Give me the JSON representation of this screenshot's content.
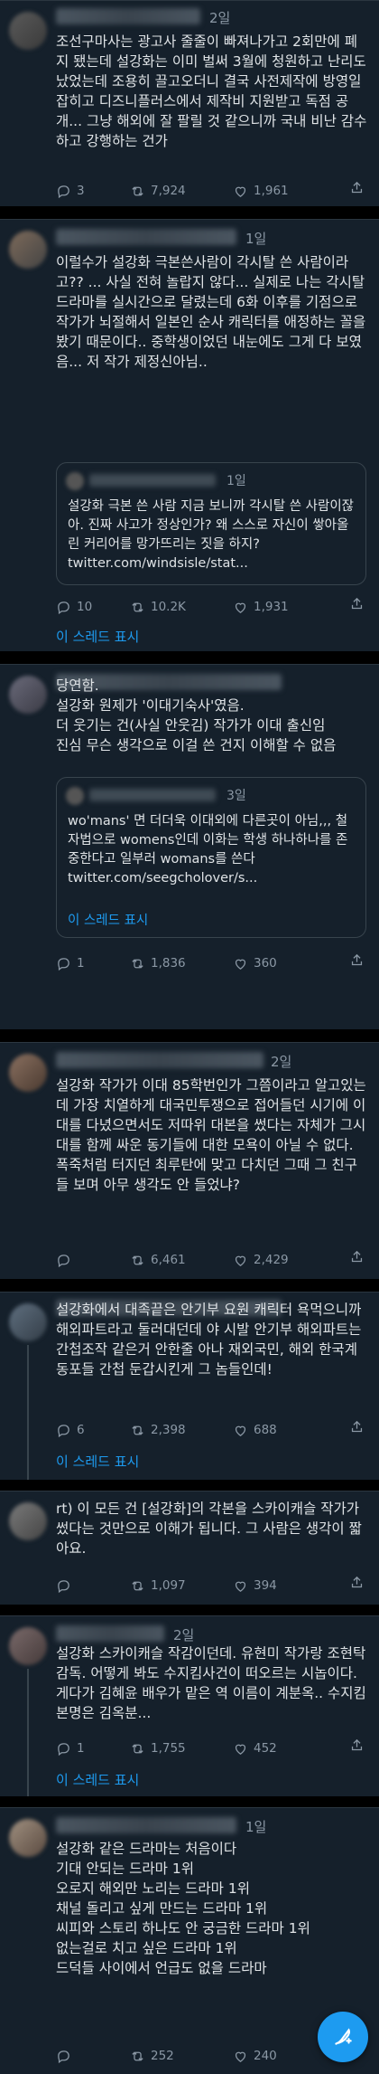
{
  "tweets": [
    {
      "time": "2일",
      "text": "조선구마사는 광고사 줄줄이 빠져나가고 2회만에 폐지 됐는데 설강화는 이미 벌써 3월에 청원하고 난리도 났었는데 조용히 끌고오더니 결국 사전제작에 방영일 잡히고 디즈니플러스에서 제작비 지원받고 독점 공개... 그냥 해외에 잘 팔릴 것 같으니까 국내 비난 감수하고 강행하는 건가",
      "replies": "3",
      "retweets": "7,924",
      "likes": "1,961"
    },
    {
      "time": "1일",
      "text": "이럴수가 설강화 극본쓴사람이 각시탈 쓴 사람이라고?? ... 사실 전혀 놀랍지 않다... 실제로 나는 각시탈 드라마를 실시간으로 달렸는데 6화 이후를 기점으로 작가가 뇌절해서 일본인 순사 캐릭터를 애정하는 꼴을 봤기 때문이다.. 중학생이었던 내눈에도 그게 다 보였음... 저 작가 제정신아님..",
      "quote": {
        "time": "1일",
        "text": "설강화 극본 쓴 사람 지금 보니까 각시탈 쓴 사람이잖아. 진짜 사고가 정상인가? 왜 스스로 자신이 쌓아올린 커리어를 망가뜨리는 짓을 하지? twitter.com/windsisle/stat..."
      },
      "replies": "10",
      "retweets": "10.2K",
      "likes": "1,931",
      "show_thread": "이 스레드 표시"
    },
    {
      "time": "",
      "text": "당연함.\n설강화 원제가 '이대기숙사'였음.\n더 웃기는 건(사실 안웃김) 작가가 이대 출신임\n진심 무슨 생각으로 이걸 쓴 건지 이해할 수 없음",
      "quote": {
        "time": "3일",
        "text": "wo'mans' 면 더더욱 이대외에 다른곳이 아님,,, 철자법으로 womens인데 이화는 학생 하나하나를 존중한다고 일부러 womans를 쓴다 twitter.com/seegcholover/s...",
        "show_thread": "이 스레드 표시"
      },
      "replies": "1",
      "retweets": "1,836",
      "likes": "360"
    },
    {
      "time": "2일",
      "text": "설강화 작가가 이대 85학번인가 그쯤이라고 알고있는데 가장 치열하게 대국민투쟁으로 접어들던 시기에 이대를 다녔으면서도 저따위 대본을 썼다는 자체가 그시대를 함께 싸운 동기들에 대한 모욕이 아닐 수 없다. 폭죽처럼 터지던 최루탄에 맞고 다치던 그때 그 친구들 보며 아무 생각도 안 들었냐?",
      "replies": "",
      "retweets": "6,461",
      "likes": "2,429"
    },
    {
      "time": "",
      "text": "설강화에서 대족끝은 안기부 요원 캐릭터 욕먹으니까 해외파트라고 둘러대던데 야 시발 안기부 해외파트는 간첩조작 같은거 안한줄 아나 재외국민, 해외 한국계 동포들 간첩 둔갑시킨게 그 놈들인데!",
      "replies": "6",
      "retweets": "2,398",
      "likes": "688",
      "show_thread": "이 스레드 표시"
    },
    {
      "time": "",
      "text": "rt) 이 모든 건 [설강화]의 각본을 스카이캐슬 작가가 썼다는 것만으로 이해가 됩니다. 그 사람은 생각이 짧아요.",
      "replies": "",
      "retweets": "1,097",
      "likes": "394"
    },
    {
      "time": "2일",
      "text": "설강화 스카이캐슬 작감이던데. 유현미 작가랑 조현탁 감독. 어떻게 봐도 수지킴사건이 떠오르는 시놉이다. 게다가 김혜윤 배우가 맡은 역 이름이 계분옥.. 수지킴 본명은 김옥분...",
      "replies": "1",
      "retweets": "1,755",
      "likes": "452",
      "show_thread": "이 스레드 표시"
    },
    {
      "time": "1일",
      "text": "설강화 같은 드라마는 처음이다\n기대 안되는 드라마 1위\n오로지 해외만 노리는 드라마 1위\n채널 돌리고 싶게 만드는 드라마 1위\n씨피와 스토리 하나도 안 궁금한 드라마 1위\n없는걸로 치고 싶은 드라마 1위\n드덕들 사이에서 언급도 없을 드라마",
      "replies": "",
      "retweets": "252",
      "likes": "240"
    }
  ],
  "icons": {
    "reply": "reply-icon",
    "retweet": "retweet-icon",
    "like": "heart-icon",
    "share": "share-icon",
    "compose": "compose-tweet-icon"
  },
  "colors": {
    "background": "#15202b",
    "link": "#1d9bf0",
    "muted": "#8b98a5"
  }
}
